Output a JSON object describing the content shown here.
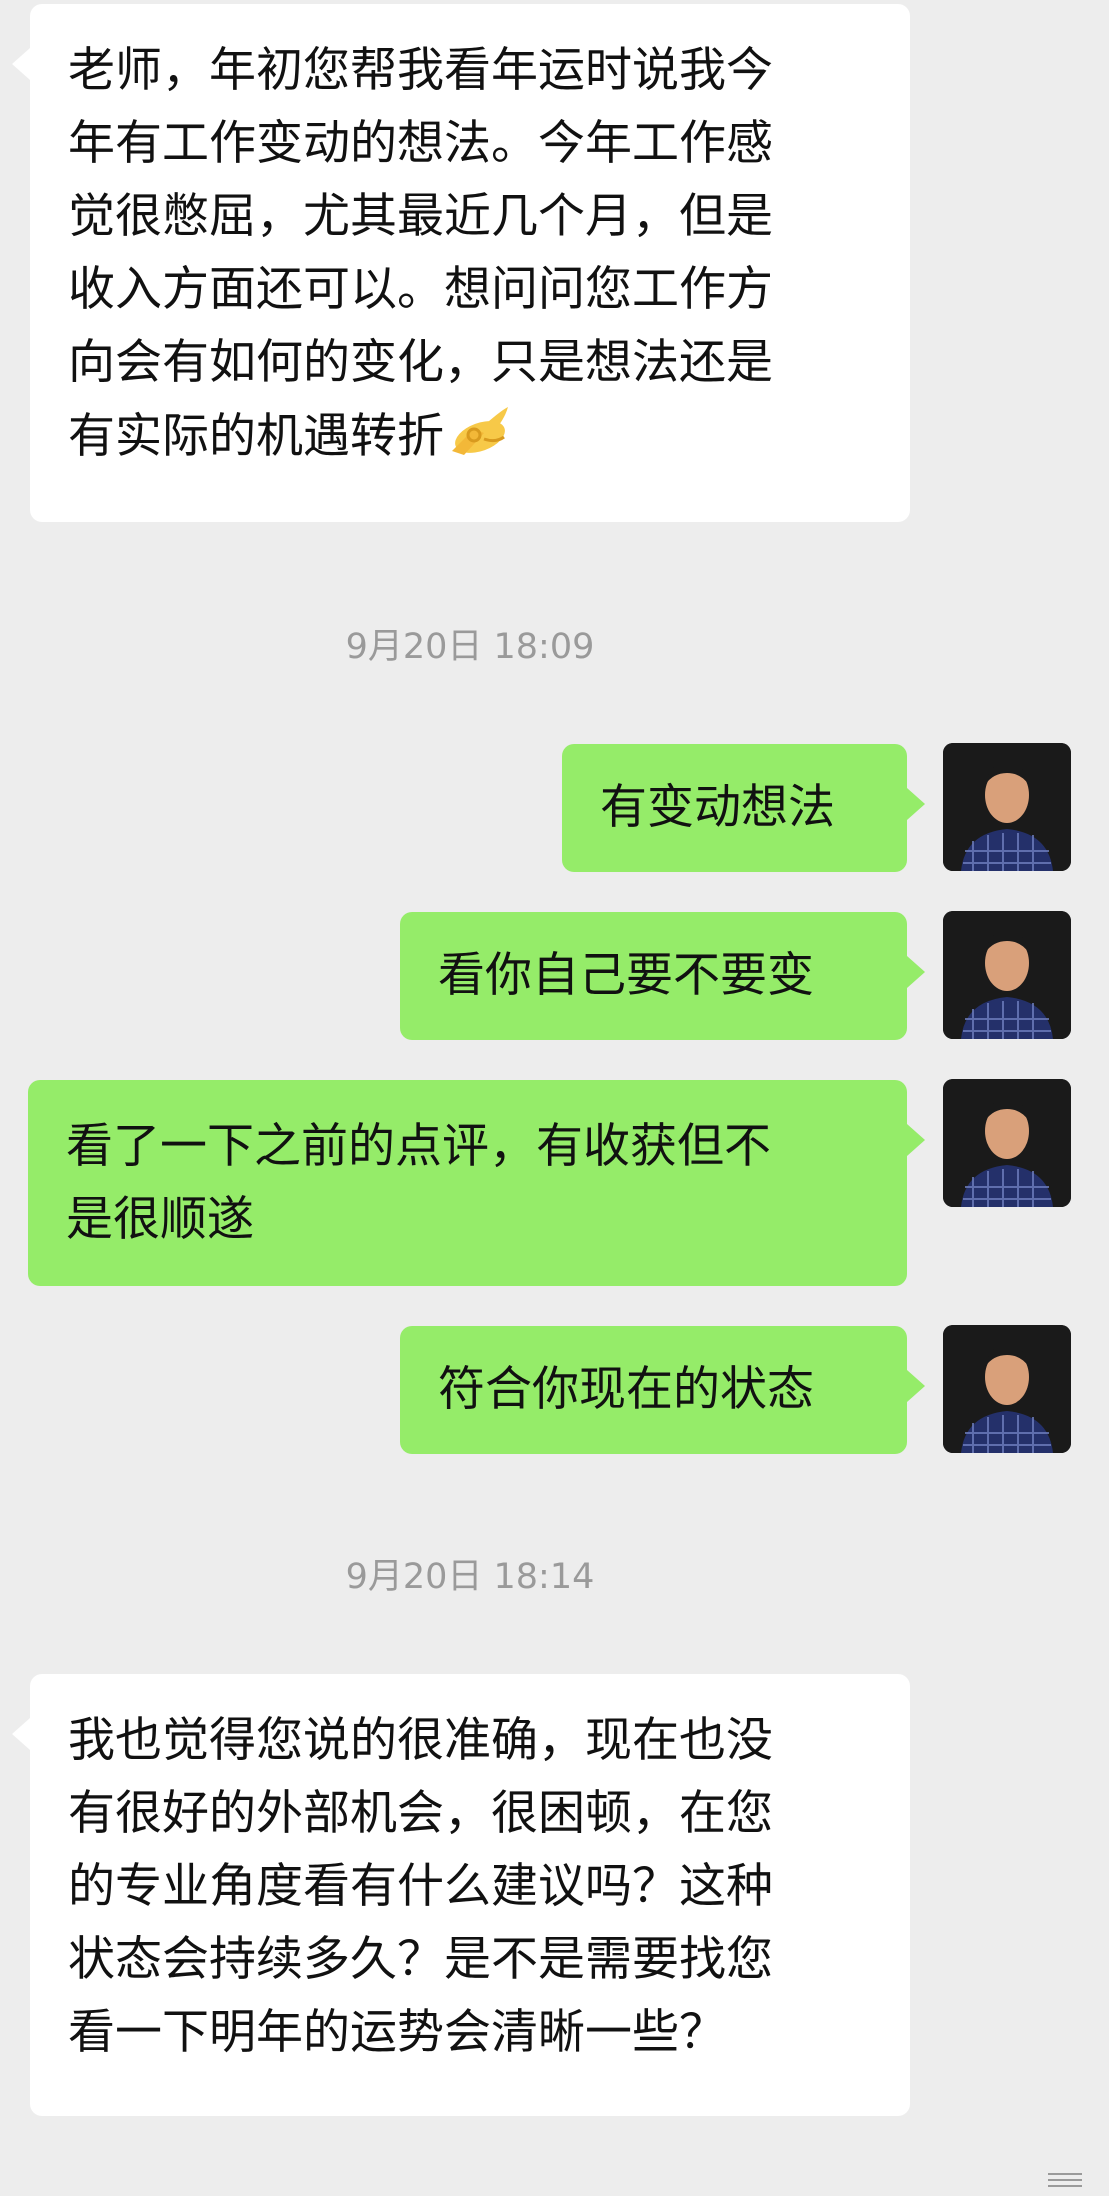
{
  "messages": [
    {
      "type": "incoming",
      "lines": [
        "老师，年初您帮我看年运时说我今",
        "年有工作变动的想法。今年工作感",
        "觉很憋屈，尤其最近几个月，但是",
        "收入方面还可以。想问问您工作方",
        "向会有如何的变化，只是想法还是",
        "有实际的机遇转折"
      ],
      "emoji": "ok-hand-emoji"
    },
    {
      "type": "timestamp",
      "text": "9月20日 18:09"
    },
    {
      "type": "outgoing",
      "text": "有变动想法"
    },
    {
      "type": "outgoing",
      "text": "看你自己要不要变"
    },
    {
      "type": "outgoing",
      "lines": [
        "看了一下之前的点评，有收获但不",
        "是很顺遂"
      ]
    },
    {
      "type": "outgoing",
      "text": "符合你现在的状态"
    },
    {
      "type": "timestamp",
      "text": "9月20日 18:14"
    },
    {
      "type": "incoming",
      "lines": [
        "我也觉得您说的很准确，现在也没",
        "有很好的外部机会，很困顿，在您",
        "的专业角度看有什么建议吗？这种",
        "状态会持续多久？是不是需要找您",
        "看一下明年的运势会清晰一些？"
      ]
    }
  ],
  "colors": {
    "background": "#ededed",
    "incoming_bubble": "#ffffff",
    "outgoing_bubble": "#95ec69",
    "timestamp_text": "#9a9a9a"
  },
  "avatar": {
    "icon": "person-avatar-icon",
    "description_color": "#1e2a5a"
  }
}
